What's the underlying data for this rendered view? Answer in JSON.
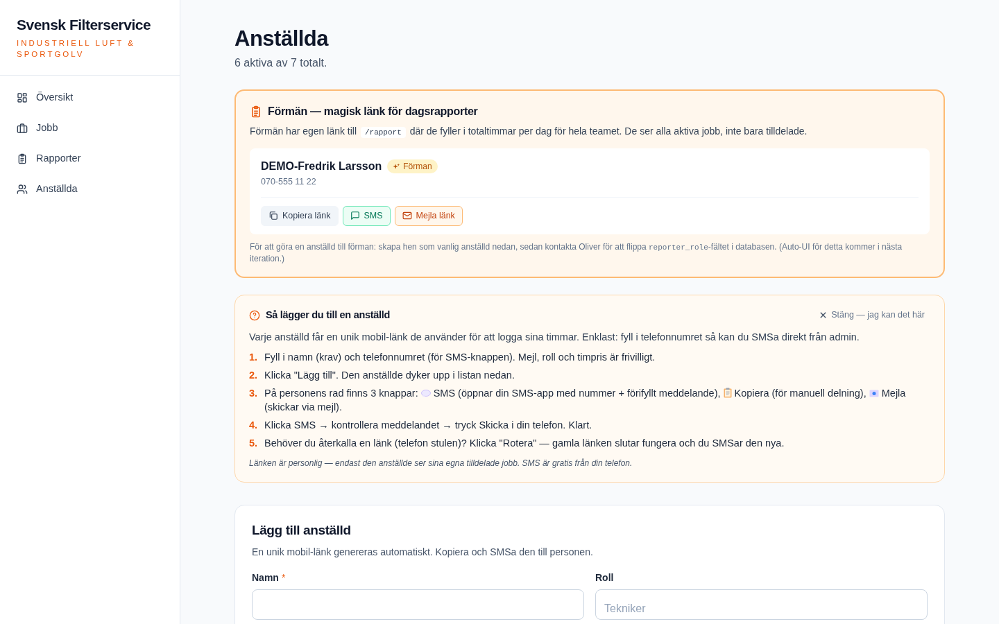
{
  "brand": {
    "name": "Svensk Filterservice",
    "tagline": "INDUSTRIELL LUFT & SPORTGOLV"
  },
  "sidebar": {
    "items": [
      {
        "label": "Översikt",
        "selected": false
      },
      {
        "label": "Jobb",
        "selected": false
      },
      {
        "label": "Rapporter",
        "selected": false
      },
      {
        "label": "Anställda",
        "selected": false
      }
    ]
  },
  "page": {
    "title": "Anställda",
    "subtitle": "6 aktiva av 7 totalt."
  },
  "foreman_panel": {
    "title": "Förmän — magisk länk för dagsrapporter",
    "description": {
      "before": "Förmän har egen länk till",
      "code": "/rapport",
      "after": "där de fyller i totaltimmar per dag för hela teamet. De ser alla aktiva jobb, inte bara tilldelade."
    },
    "person": {
      "name": "DEMO-Fredrik Larsson",
      "badge": "Förman",
      "phone": "070-555 11 22"
    },
    "buttons": [
      {
        "label": "Kopiera länk",
        "kind": "copy"
      },
      {
        "label": "SMS",
        "kind": "sms"
      },
      {
        "label": "Mejla länk",
        "kind": "mail"
      }
    ],
    "note": {
      "before": "För att göra en anställd till förman: skapa hen som vanlig anställd nedan, sedan kontakta Oliver för att flippa",
      "code": "reporter_role",
      "after": "-fältet i databasen. (Auto-UI för detta kommer i nästa iteration.)"
    }
  },
  "help_panel": {
    "title": "Så lägger du till en anställd",
    "close": "Stäng — jag kan det här",
    "intro": "Varje anställd får en unik mobil-länk de använder för att logga sina timmar. Enklast: fyll i telefonnumret så kan du SMSa direkt från admin.",
    "steps": [
      {
        "number": "1.",
        "segments": [
          "Fyll i namn (krav) och telefonnumret (för SMS-knappen). Mejl, roll och timpris är frivilligt."
        ]
      },
      {
        "number": "2.",
        "segments": [
          "Klicka \"Lägg till\". Den anställde dyker upp i listan nedan."
        ]
      },
      {
        "number": "3.",
        "segments": [
          "På personens rad finns 3 knappar:",
          "SMS (öppnar din SMS-app med nummer + förifyllt meddelande),",
          "Kopiera (för manuell delning),",
          "Mejla (skickar via mejl)."
        ]
      },
      {
        "number": "4.",
        "segments": [
          "Klicka SMS → kontrollera meddelandet → tryck Skicka i din telefon. Klart."
        ]
      },
      {
        "number": "5.",
        "segments": [
          "Behöver du återkalla en länk (telefon stulen)? Klicka \"Rotera\" — gamla länken slutar fungera och du SMSar den nya."
        ]
      }
    ],
    "footnote": "Länken är personlig — endast den anställde ser sina egna tilldelade jobb. SMS är gratis från din telefon."
  },
  "add_form": {
    "title": "Lägg till anställd",
    "subtitle": "En unik mobil-länk genereras automatiskt. Kopiera och SMSa den till personen.",
    "fields": [
      {
        "label": "Namn",
        "required_mark": "*"
      },
      {
        "label": "Roll",
        "placeholder": "Tekniker"
      }
    ]
  }
}
